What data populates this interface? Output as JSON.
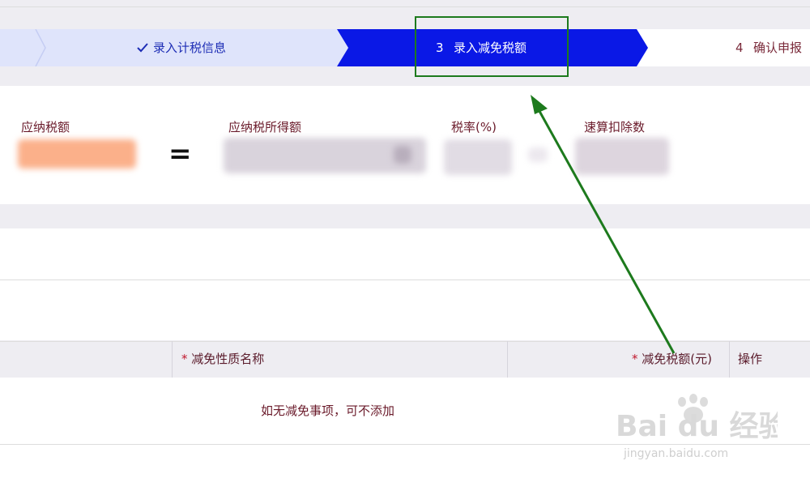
{
  "stepper": {
    "steps": [
      {
        "label": "录入计税信息",
        "status": "done"
      },
      {
        "number": "3",
        "label": "录入减免税额",
        "status": "active"
      },
      {
        "number": "4",
        "label": "确认申报",
        "status": "pending"
      }
    ],
    "active_color": "#0a18e6",
    "done_color": "#dfe4fb"
  },
  "formula": {
    "payable_tax_label": "应纳税额",
    "equals": "=",
    "taxable_income_label": "应纳税所得额",
    "tax_rate_label": "税率(%)",
    "quick_deduction_label": "速算扣除数"
  },
  "table": {
    "required_mark": "*",
    "columns": [
      "减免性质名称",
      "减免税额(元)",
      "操作"
    ],
    "empty_message": "如无减免事项，可不添加"
  },
  "watermark": {
    "brand": "Bai du 经验",
    "url": "jingyan.baidu.com"
  },
  "annotation_color": "#1d7a1d"
}
